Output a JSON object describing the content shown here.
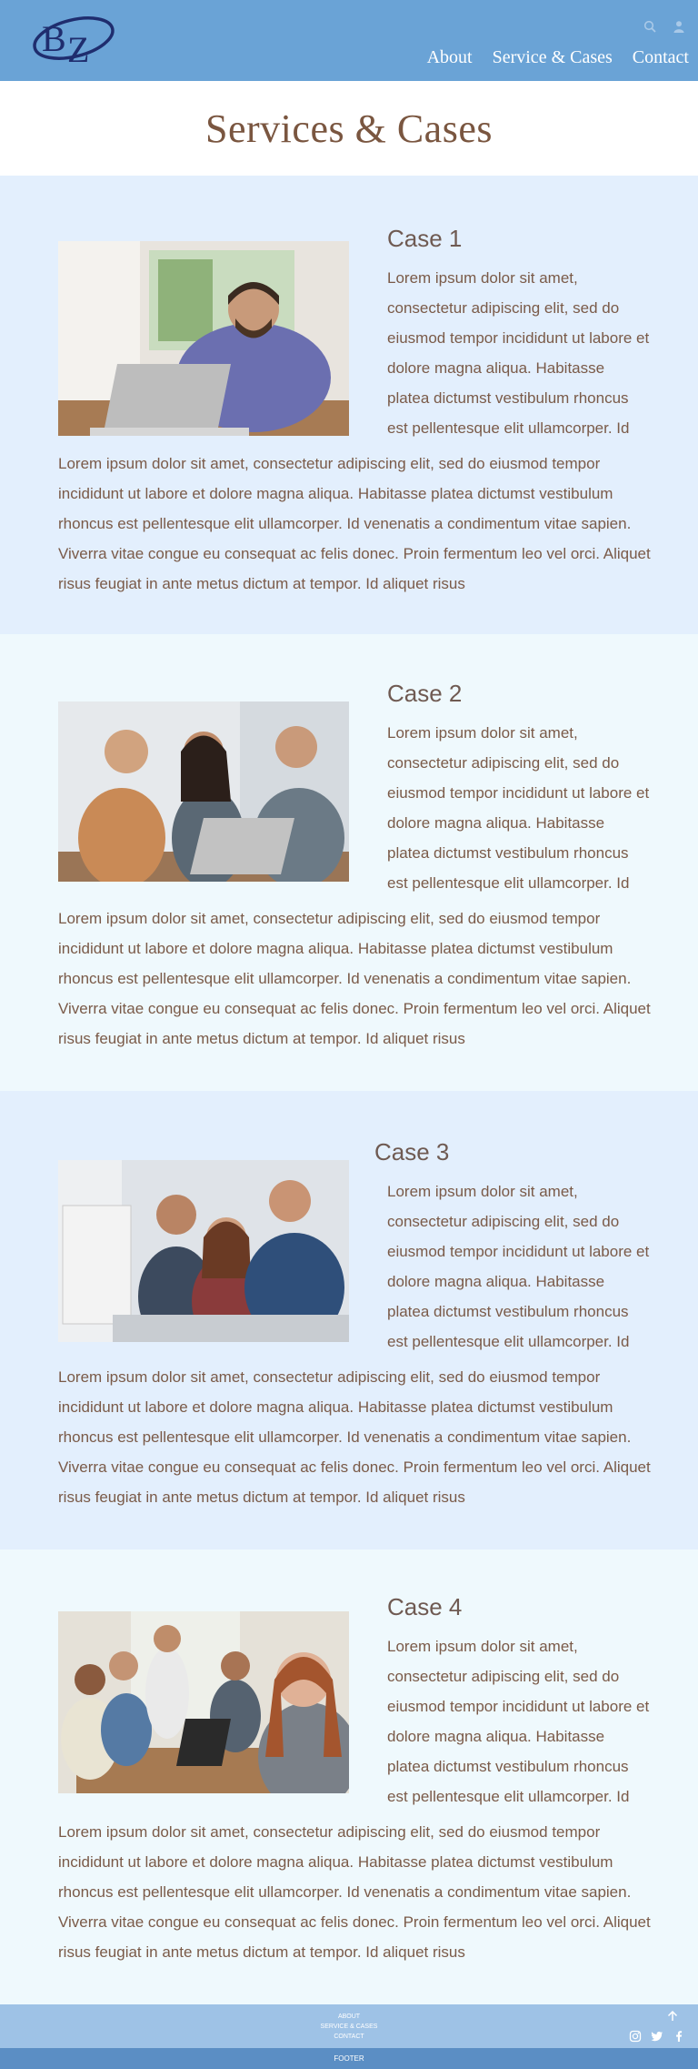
{
  "header": {
    "logo_text": "BZ",
    "icons": [
      "search-icon",
      "user-icon"
    ],
    "nav": [
      "About",
      "Service & Cases",
      "Contact"
    ]
  },
  "page": {
    "title": "Services & Cases"
  },
  "cases": [
    {
      "title": "Case 1",
      "side_text": "Lorem ipsum dolor sit amet, consectetur adipiscing elit, sed do eiusmod tempor incididunt ut labore et dolore magna aliqua. Habitasse platea dictumst vestibulum rhoncus est pellentesque elit ullamcorper. Id",
      "full_text": "Lorem ipsum dolor sit amet, consectetur adipiscing elit, sed do eiusmod tempor incididunt ut labore et dolore magna aliqua. Habitasse platea dictumst vestibulum rhoncus est pellentesque elit ullamcorper. Id venenatis a condimentum vitae sapien. Viverra vitae congue eu consequat ac felis donec. Proin fermentum leo vel orci. Aliquet risus feugiat in ante metus dictum at tempor. Id aliquet risus"
    },
    {
      "title": "Case 2",
      "side_text": "Lorem ipsum dolor sit amet, consectetur adipiscing elit, sed do eiusmod tempor incididunt ut labore et dolore magna aliqua. Habitasse platea dictumst vestibulum rhoncus est pellentesque elit ullamcorper. Id",
      "full_text": "Lorem ipsum dolor sit amet, consectetur adipiscing elit, sed do eiusmod tempor incididunt ut labore et dolore magna aliqua. Habitasse platea dictumst vestibulum rhoncus est pellentesque elit ullamcorper. Id venenatis a condimentum vitae sapien. Viverra vitae congue eu consequat ac felis donec. Proin fermentum leo vel orci. Aliquet risus feugiat in ante metus dictum at tempor. Id aliquet risus"
    },
    {
      "title": "Case 3",
      "side_text": "Lorem ipsum dolor sit amet, consectetur adipiscing elit, sed do eiusmod tempor incididunt ut labore et dolore magna aliqua. Habitasse platea dictumst vestibulum rhoncus est pellentesque elit ullamcorper. Id",
      "full_text": "Lorem ipsum dolor sit amet, consectetur adipiscing elit, sed do eiusmod tempor incididunt ut labore et dolore magna aliqua. Habitasse platea dictumst vestibulum rhoncus est pellentesque elit ullamcorper. Id venenatis a condimentum vitae sapien. Viverra vitae congue eu consequat ac felis donec. Proin fermentum leo vel orci. Aliquet risus feugiat in ante metus dictum at tempor. Id aliquet risus"
    },
    {
      "title": "Case 4",
      "side_text": "Lorem ipsum dolor sit amet, consectetur adipiscing elit, sed do eiusmod tempor incididunt ut labore et dolore magna aliqua. Habitasse platea dictumst vestibulum rhoncus est pellentesque elit ullamcorper. Id",
      "full_text": "Lorem ipsum dolor sit amet, consectetur adipiscing elit, sed do eiusmod tempor incididunt ut labore et dolore magna aliqua. Habitasse platea dictumst vestibulum rhoncus est pellentesque elit ullamcorper. Id venenatis a condimentum vitae sapien. Viverra vitae congue eu consequat ac felis donec. Proin fermentum leo vel orci. Aliquet risus feugiat in ante metus dictum at tempor. Id aliquet risus"
    }
  ],
  "footer": {
    "links": [
      "About",
      "Service & Cases",
      "Contact"
    ],
    "bottom_label": "FOOTER",
    "icons": [
      "arrow-up-icon",
      "instagram-icon",
      "twitter-icon",
      "facebook-icon"
    ]
  },
  "colors": {
    "header_bg": "#6aa3d6",
    "section_blue": "#e3effd",
    "section_cyan": "#eff9fd",
    "text_brown": "#7a5a48",
    "footer_main": "#9ec2e6",
    "footer_bar": "#5b8ec4"
  }
}
